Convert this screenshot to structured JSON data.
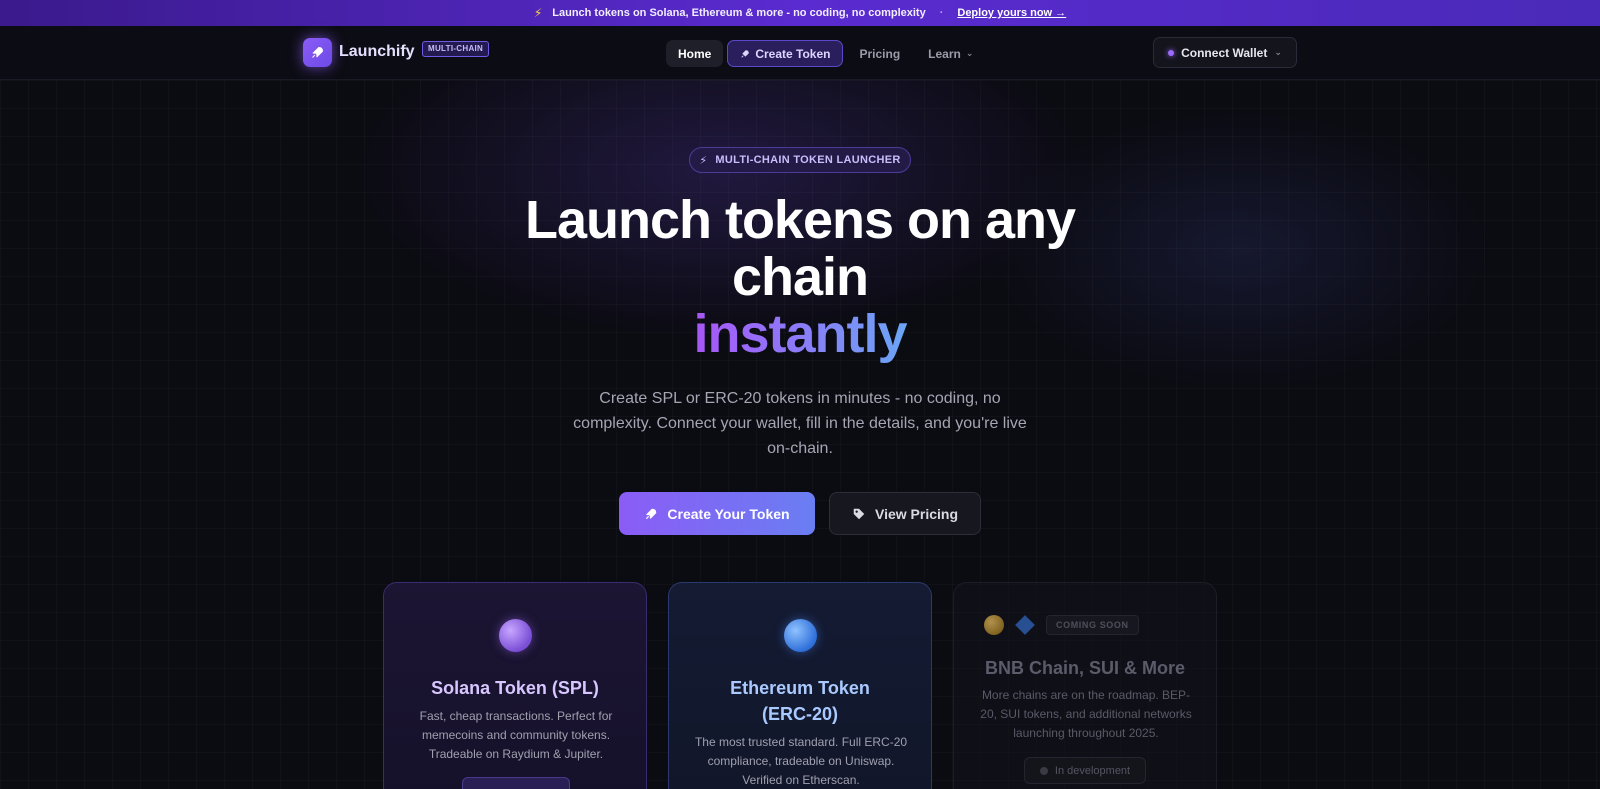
{
  "announcement": {
    "text": "Launch tokens on Solana, Ethereum & more - no coding, no complexity",
    "separator": "·",
    "cta": "Deploy yours now →"
  },
  "nav": {
    "brand": "Launchify",
    "brand_badge": "MULTI-CHAIN",
    "links": [
      {
        "label": "Home"
      },
      {
        "label": "Create Token"
      },
      {
        "label": "Pricing"
      },
      {
        "label": "Learn"
      }
    ],
    "wallet_label": "Connect Wallet"
  },
  "hero": {
    "pill": "MULTI-CHAIN TOKEN LAUNCHER",
    "title_line1": "Launch tokens on any",
    "title_line2": "chain",
    "title_highlight": "instantly",
    "subtitle": "Create SPL or ERC-20 tokens in minutes - no coding, no complexity. Connect your wallet, fill in the details, and you're live on-chain.",
    "primary_cta": "Create Your Token",
    "secondary_cta": "View Pricing"
  },
  "cards": [
    {
      "title": "Solana Token (SPL)",
      "description": "Fast, cheap transactions. Perfect for memecoins and community tokens. Tradeable on Raydium & Jupiter."
    },
    {
      "title": "Ethereum Token (ERC-20)",
      "description": "The most trusted standard. Full ERC-20 compliance, tradeable on Uniswap. Verified on Etherscan."
    },
    {
      "badge": "COMING SOON",
      "title": "BNB Chain, SUI & More",
      "description": "More chains are on the roadmap. BEP-20, SUI tokens, and additional networks launching throughout 2025.",
      "status": "In development"
    }
  ],
  "colors": {
    "accent_purple": "#8b5cf6",
    "accent_blue": "#6aa6f5",
    "background": "#0b0b12"
  }
}
